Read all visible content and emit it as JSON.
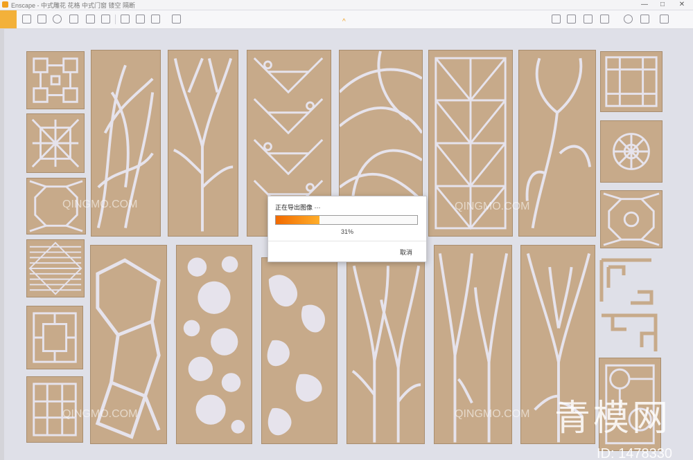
{
  "window": {
    "title": "Enscape - 中式雕花 花格 中式门窗 镂空 隔断",
    "controls": [
      "—",
      "□",
      "✕"
    ]
  },
  "toolbar": {
    "collapse_symbol": "^",
    "icons": [
      "home-icon",
      "pen-icon",
      "measure-icon",
      "camera-icon",
      "walk-icon",
      "screenshot-icon",
      "batch-icon",
      "export-icon",
      "asset-icon",
      "settings-icon",
      "visual-settings-icon",
      "feedback-icon"
    ]
  },
  "export_dialog": {
    "title": "正在导出图像 ···",
    "progress_value": 0.31,
    "progress_text": "31%",
    "cancel_label": "取消"
  },
  "watermark": {
    "site_text": "QINGMO.COM",
    "logo_text": "青模网",
    "id_text": "ID: 1478330"
  },
  "colors": {
    "wood": "#c7aa8a",
    "wood_dark": "#a88d6e",
    "background": "#dfe0e8",
    "progress_start": "#f26a00",
    "progress_end": "#ffae2a",
    "home_button": "#f3b13a"
  }
}
